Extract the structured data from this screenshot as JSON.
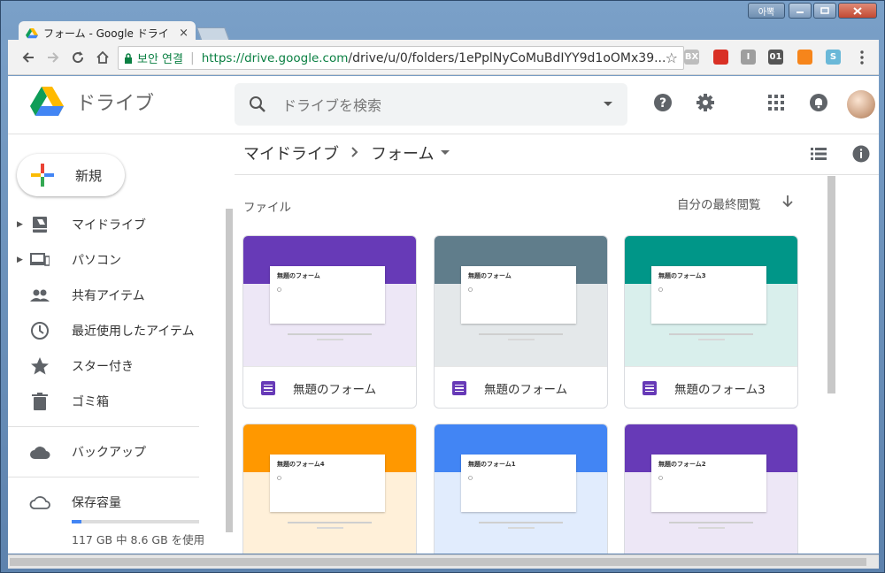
{
  "browser": {
    "tab_title": "フォーム - Google ドライ",
    "tab_close": "×",
    "ime_label": "아뽁",
    "secure_label": "보안 연결",
    "url_host": "https://drive.google.com",
    "url_path": "/drive/u/0/folders/1ePplNyCoMuBdIYY9d1oOMx39...",
    "extensions": [
      {
        "name": "ext-gray-icon",
        "label": "BX",
        "color": "#bdbdbd"
      },
      {
        "name": "ext-red-icon",
        "label": "",
        "color": "#d93025"
      },
      {
        "name": "ext-i-icon",
        "label": "I",
        "color": "#9e9e9e"
      },
      {
        "name": "ext-01-icon",
        "label": "01",
        "color": "#555555"
      },
      {
        "name": "metamask-icon",
        "label": "",
        "color": "#f6851b"
      },
      {
        "name": "ext-s-icon",
        "label": "S",
        "color": "#6ab8d8"
      }
    ]
  },
  "app": {
    "logo_text": "ドライブ",
    "search_placeholder": "ドライブを検索",
    "new_button": "新規",
    "nav": [
      {
        "label": "マイドライブ",
        "icon": "my-drive-icon",
        "arrow": true
      },
      {
        "label": "パソコン",
        "icon": "computers-icon",
        "arrow": true
      },
      {
        "label": "共有アイテム",
        "icon": "shared-icon",
        "arrow": false
      },
      {
        "label": "最近使用したアイテム",
        "icon": "recent-icon",
        "arrow": false
      },
      {
        "label": "スター付き",
        "icon": "star-icon",
        "arrow": false
      },
      {
        "label": "ゴミ箱",
        "icon": "trash-icon",
        "arrow": false
      }
    ],
    "backup_label": "バックアップ",
    "storage_label": "保存容量",
    "storage_text": "117 GB 中 8.6 GB を使用",
    "storage_fraction": 0.074,
    "breadcrumb": [
      "マイドライブ",
      "フォーム"
    ],
    "section_title": "ファイル",
    "sort_label": "自分の最終閲覧",
    "files": [
      {
        "name": "無題のフォーム",
        "thumb_title": "無題のフォーム",
        "band": "#673ab7",
        "bg": "#ede7f6"
      },
      {
        "name": "無題のフォーム",
        "thumb_title": "無題のフォーム",
        "band": "#607d8b",
        "bg": "#e4e8ea"
      },
      {
        "name": "無題のフォーム3",
        "thumb_title": "無題のフォーム3",
        "band": "#009688",
        "bg": "#d9efec"
      },
      {
        "name": "",
        "thumb_title": "無題のフォーム4",
        "band": "#ff9800",
        "bg": "#fff0d9"
      },
      {
        "name": "",
        "thumb_title": "無題のフォーム1",
        "band": "#4285f4",
        "bg": "#e1ecfd"
      },
      {
        "name": "",
        "thumb_title": "無題のフォーム2",
        "band": "#673ab7",
        "bg": "#ede7f6"
      }
    ]
  }
}
